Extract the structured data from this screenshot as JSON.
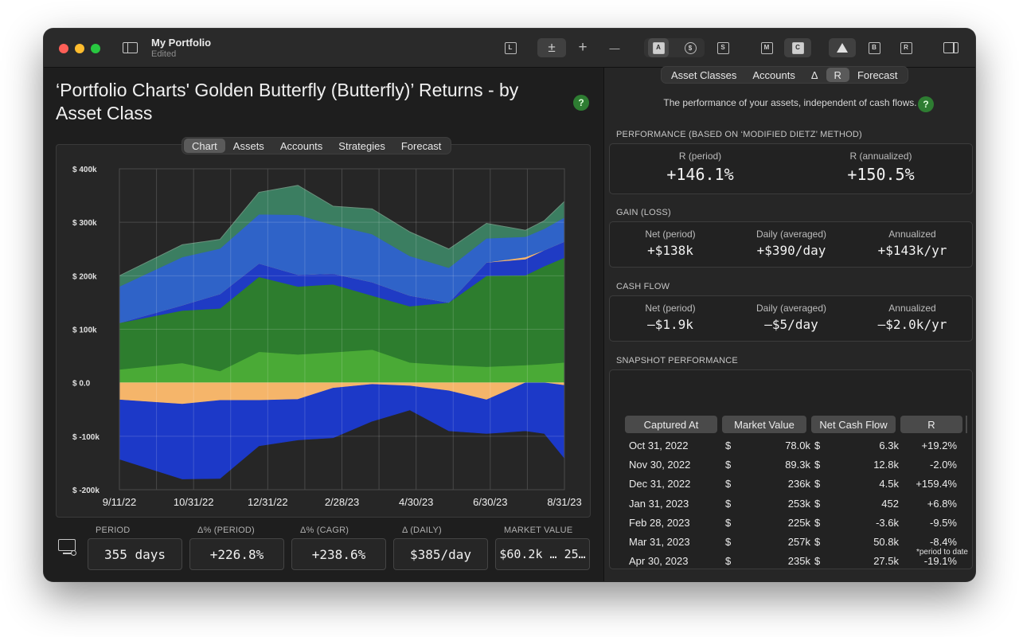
{
  "window": {
    "title": "My Portfolio",
    "subtitle": "Edited"
  },
  "toolbar": {
    "buttons": [
      "L",
      "±",
      "+",
      "—",
      "A",
      "$",
      "S",
      "M",
      "C",
      "",
      "B",
      "R"
    ]
  },
  "left": {
    "title": "‘Portfolio Charts' Golden Butterfly (Butterfly)’ Returns - by Asset Class",
    "help": "?",
    "tabs": [
      "Chart",
      "Assets",
      "Accounts",
      "Strategies",
      "Forecast"
    ],
    "active_tab": "Chart",
    "stats": [
      {
        "label": "PERIOD",
        "value": "355 days"
      },
      {
        "label": "Δ% (PERIOD)",
        "value": "+226.8%"
      },
      {
        "label": "Δ% (CAGR)",
        "value": "+238.6%"
      },
      {
        "label": "Δ (DAILY)",
        "value": "$385/day"
      },
      {
        "label": "MARKET VALUE",
        "value": "$60.2k … 25…"
      }
    ]
  },
  "chart_data": {
    "type": "area",
    "stacked": true,
    "ylim": [
      -200000,
      400000
    ],
    "ytick_labels": [
      "$  400k",
      "$  300k",
      "$  200k",
      "$  100k",
      "$      0.0",
      "$  -100k",
      "$  -200k"
    ],
    "yticks": [
      400000,
      300000,
      200000,
      100000,
      0,
      -100000,
      -200000
    ],
    "xtick_labels": [
      "9/11/22",
      "10/31/22",
      "12/31/22",
      "2/28/23",
      "4/30/23",
      "6/30/23",
      "8/31/23"
    ],
    "x": [
      "2022-09-11",
      "2022-10-31",
      "2022-11-30",
      "2022-12-31",
      "2023-01-31",
      "2023-02-28",
      "2023-03-31",
      "2023-04-30",
      "2023-05-31",
      "2023-06-30",
      "2023-07-31",
      "2023-08-15",
      "2023-08-31"
    ],
    "positive_layers": [
      {
        "color": "#4aaa36",
        "values": [
          25000,
          37000,
          22000,
          58000,
          53000,
          57000,
          62000,
          38000,
          33000,
          30000,
          33000,
          35000,
          38000
        ]
      },
      {
        "color": "#2d7d2e",
        "values": [
          87000,
          98000,
          117000,
          140000,
          127000,
          127000,
          101000,
          105000,
          117000,
          170000,
          168000,
          183000,
          196000
        ]
      },
      {
        "color": "#1f3bc4",
        "values": [
          0,
          10000,
          27000,
          25000,
          22000,
          20000,
          25000,
          20000,
          0,
          25000,
          30000,
          30000,
          30000
        ]
      },
      {
        "color": "#f5b56a",
        "values": [
          0,
          0,
          0,
          0,
          0,
          0,
          0,
          0,
          0,
          0,
          4000,
          0,
          0
        ]
      },
      {
        "color": "#2f63c8",
        "values": [
          68000,
          90000,
          85000,
          92000,
          112000,
          91000,
          90000,
          74000,
          65000,
          45000,
          38000,
          40000,
          45000
        ]
      },
      {
        "color": "#3b7e61",
        "values": [
          20000,
          23000,
          17000,
          41000,
          55000,
          35000,
          47000,
          45000,
          35000,
          28000,
          12000,
          15000,
          30000
        ]
      }
    ],
    "negative_layers": [
      {
        "color": "#f5b56a",
        "values": [
          -32000,
          -40000,
          -33000,
          -33000,
          -31000,
          -10000,
          -3000,
          -6000,
          -15000,
          -32000,
          0,
          0,
          -5000
        ]
      },
      {
        "color": "#1c39c8",
        "values": [
          -111000,
          -140000,
          -146000,
          -85000,
          -76000,
          -93000,
          -69000,
          -45000,
          -75000,
          -63000,
          -90000,
          -95000,
          -136000
        ]
      }
    ]
  },
  "right": {
    "tabs": [
      "Asset Classes",
      "Accounts",
      "Δ",
      "R",
      "Forecast"
    ],
    "active_tab": "R",
    "description": "The performance of your assets, independent of cash flows.",
    "performance": {
      "header": "PERFORMANCE (BASED ON ‘MODIFIED DIETZ’ METHOD)",
      "items": [
        {
          "label": "R (period)",
          "value": "+146.1%"
        },
        {
          "label": "R (annualized)",
          "value": "+150.5%"
        }
      ]
    },
    "gain": {
      "header": "GAIN (LOSS)",
      "items": [
        {
          "label": "Net (period)",
          "value": "+$138k"
        },
        {
          "label": "Daily (averaged)",
          "value": "+$390/day"
        },
        {
          "label": "Annualized",
          "value": "+$143k/yr"
        }
      ]
    },
    "cashflow": {
      "header": "CASH FLOW",
      "items": [
        {
          "label": "Net (period)",
          "value": "–$1.9k"
        },
        {
          "label": "Daily (averaged)",
          "value": "–$5/day"
        },
        {
          "label": "Annualized",
          "value": "–$2.0k/yr"
        }
      ]
    },
    "snapshot": {
      "header": "SNAPSHOT PERFORMANCE",
      "columns": [
        "Captured At",
        "Market Value",
        "Net Cash Flow",
        "R"
      ],
      "rows": [
        {
          "date": "Oct 31, 2022",
          "mv": "78.0k",
          "ncf": "6.3k",
          "r": "+19.2%"
        },
        {
          "date": "Nov 30, 2022",
          "mv": "89.3k",
          "ncf": "12.8k",
          "r": "-2.0%"
        },
        {
          "date": "Dec 31, 2022",
          "mv": "236k",
          "ncf": "4.5k",
          "r": "+159.4%"
        },
        {
          "date": "Jan 31, 2023",
          "mv": "253k",
          "ncf": "452",
          "r": "+6.8%"
        },
        {
          "date": "Feb 28, 2023",
          "mv": "225k",
          "ncf": "-3.6k",
          "r": "-9.5%"
        },
        {
          "date": "Mar 31, 2023",
          "mv": "257k",
          "ncf": "50.8k",
          "r": "-8.4%"
        },
        {
          "date": "Apr 30, 2023",
          "mv": "235k",
          "ncf": "27.5k",
          "r": "-19.1%"
        }
      ],
      "currency": "$",
      "footnote": "*period to date"
    }
  },
  "colors": {
    "accent_green": "#2e7d32",
    "window_bg": "#1e1e1e",
    "panel_bg": "#262626"
  }
}
